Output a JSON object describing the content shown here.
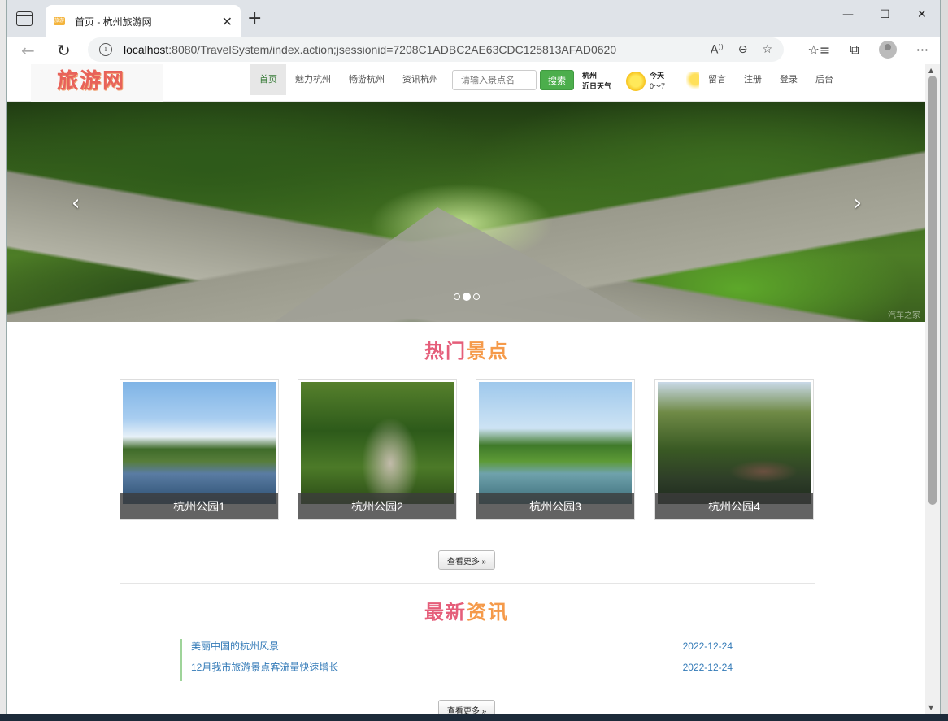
{
  "browser": {
    "tab_title": "首页 - 杭州旅游网",
    "tab_favicon_text": "旅游",
    "url_host": "localhost",
    "url_rest": ":8080/TravelSystem/index.action;jsessionid=7208C1ADBC2AE63CDC125813AFAD0620"
  },
  "site": {
    "logo": "旅游网",
    "nav": [
      "首页",
      "魅力杭州",
      "畅游杭州",
      "资讯杭州"
    ],
    "search_placeholder": "请输入景点名",
    "search_button": "搜索",
    "weather": {
      "city": "杭州",
      "subtitle": "近日天气",
      "today_label": "今天",
      "temp_range": "0～7"
    },
    "nav_right": [
      "留言",
      "注册",
      "登录",
      "后台"
    ]
  },
  "carousel": {
    "prev": "‹",
    "next": "›",
    "slide_count": 3,
    "active_index": 1,
    "watermark": "汽车之家"
  },
  "hot_spots": {
    "title_main": "热门",
    "title_accent": "景点",
    "items": [
      {
        "name": "杭州公园1"
      },
      {
        "name": "杭州公园2"
      },
      {
        "name": "杭州公园3"
      },
      {
        "name": "杭州公园4"
      }
    ],
    "more_label": "查看更多 »"
  },
  "news": {
    "title_main": "最新",
    "title_accent": "资讯",
    "items": [
      {
        "title": "美丽中国的杭州风景",
        "date": "2022-12-24"
      },
      {
        "title": "12月我市旅游景点客流量快速增长",
        "date": "2022-12-24"
      }
    ],
    "more_label": "查看更多 »"
  },
  "colors": {
    "search_button": "#4cae4c",
    "section_title": "#e55e7a",
    "section_accent": "#f59a4a",
    "news_link": "#337ab7"
  }
}
